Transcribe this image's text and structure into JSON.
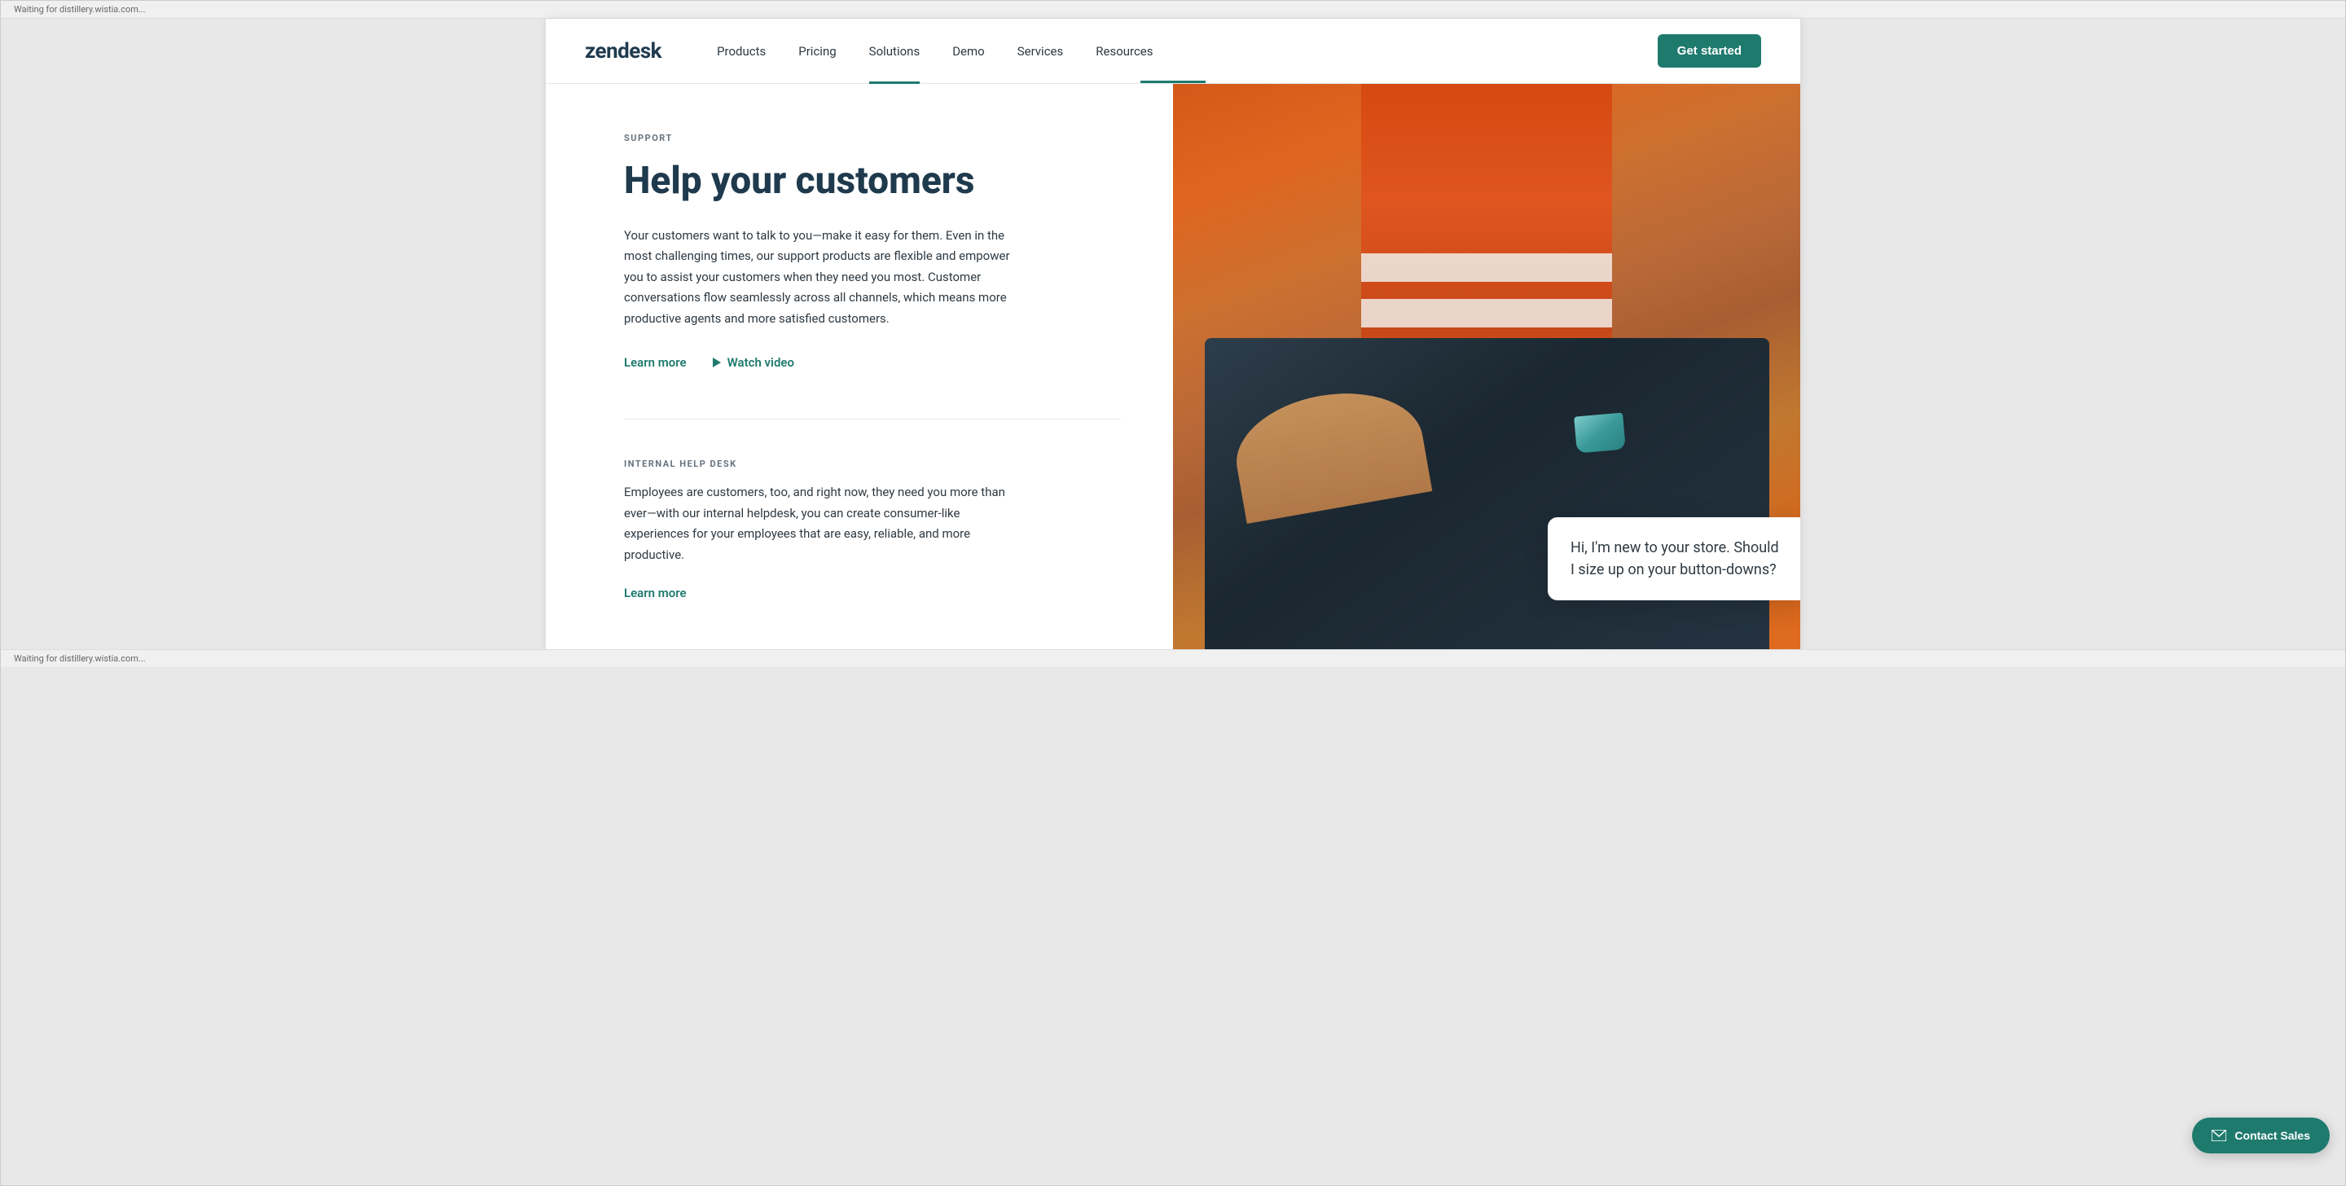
{
  "browser": {
    "status_text": "Waiting for distillery.wistia.com..."
  },
  "header": {
    "logo_text": "zendesk",
    "nav_items": [
      {
        "label": "Products",
        "active": false
      },
      {
        "label": "Pricing",
        "active": false
      },
      {
        "label": "Solutions",
        "active": true
      },
      {
        "label": "Demo",
        "active": false
      },
      {
        "label": "Services",
        "active": false
      },
      {
        "label": "Resources",
        "active": false
      }
    ],
    "cta_button": "Get started"
  },
  "hero": {
    "section_label": "SUPPORT",
    "heading": "Help your customers",
    "description": "Your customers want to talk to you—make it easy for them. Even in the most challenging times, our support products are flexible and empower you to assist your customers when they need you most. Customer conversations flow seamlessly across all channels, which means more productive agents and more satisfied customers.",
    "learn_more": "Learn more",
    "watch_video": "Watch video",
    "internal_section_label": "INTERNAL HELP DESK",
    "internal_description": "Employees are customers, too, and right now, they need you more than ever—with our internal helpdesk, you can create consumer-like experiences for your employees that are easy, reliable, and more productive.",
    "internal_learn_more": "Learn more",
    "chat_bubble_text": "Hi, I'm new to your store. Should I size up on your button-downs?"
  },
  "contact_sales": {
    "button_label": "Contact Sales"
  }
}
